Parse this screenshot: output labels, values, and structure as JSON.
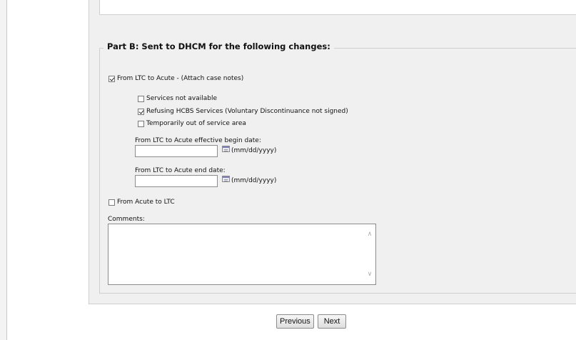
{
  "partB": {
    "title": "Part B: Sent to DHCM for the following changes:",
    "ltc_to_acute": {
      "label": "From LTC to Acute - (Attach case notes)",
      "checked": true
    },
    "reasons": [
      {
        "label": "Services not available",
        "checked": false
      },
      {
        "label": "Refusing HCBS Services (Voluntary Discontinuance not signed)",
        "checked": true
      },
      {
        "label": "Temporarily out of service area",
        "checked": false
      }
    ],
    "begin_date": {
      "label": "From LTC to Acute effective begin date:",
      "value": "",
      "hint": "(mm/dd/yyyy)"
    },
    "end_date": {
      "label": "From LTC to Acute end date:",
      "value": "",
      "hint": "(mm/dd/yyyy)"
    },
    "acute_to_ltc": {
      "label": "From Acute to LTC",
      "checked": false
    },
    "comments": {
      "label": "Comments:",
      "value": ""
    }
  },
  "nav": {
    "previous_label": "Previous",
    "next_label": "Next"
  },
  "colors": {
    "panel": "#f0f0f0",
    "border": "#cfcfcf",
    "background": "#ffffff"
  }
}
